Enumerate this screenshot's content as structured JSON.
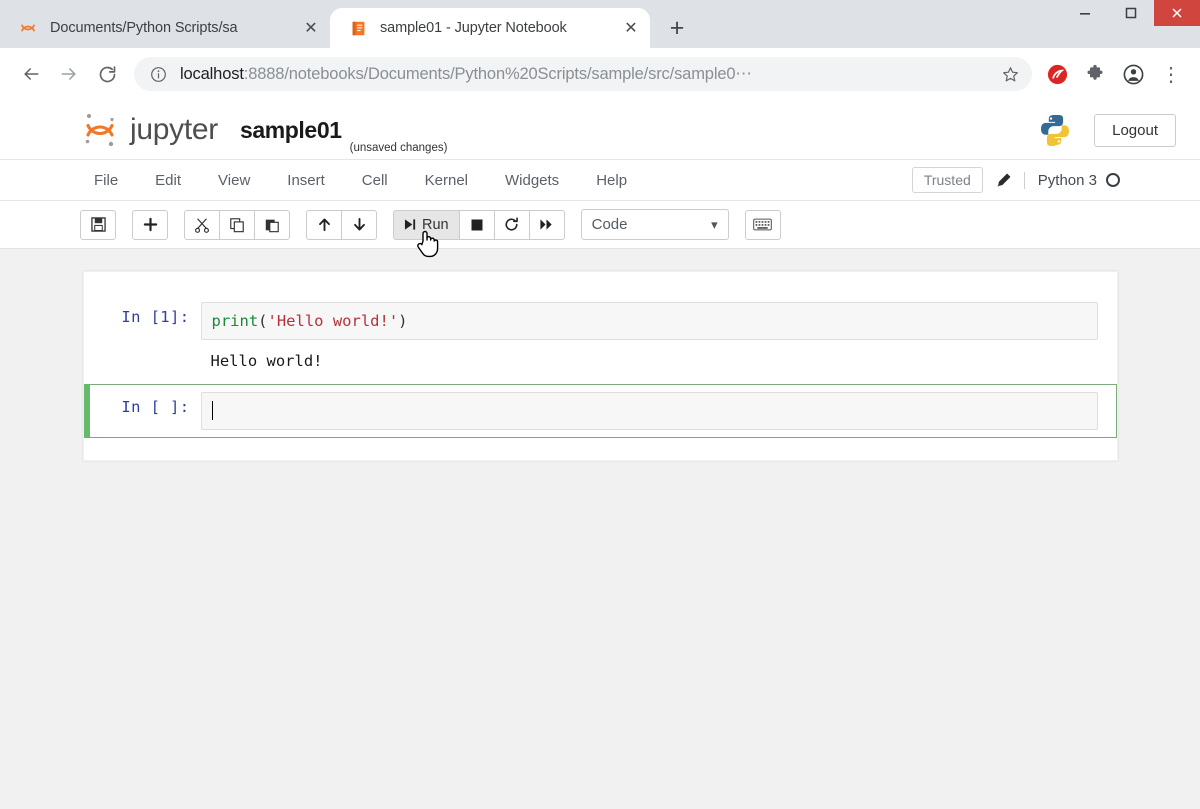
{
  "window": {
    "controls": [
      {
        "name": "minimize",
        "glyph": "—"
      },
      {
        "name": "maximize",
        "glyph": "❐"
      },
      {
        "name": "close",
        "glyph": "✕"
      }
    ]
  },
  "tabs": [
    {
      "title": "Documents/Python Scripts/sa",
      "favicon": "jupyter-icon",
      "active": false,
      "close_glyph": "✕"
    },
    {
      "title": "sample01 - Jupyter Notebook",
      "favicon": "notebook-icon",
      "active": true,
      "close_glyph": "✕"
    }
  ],
  "new_tab_glyph": "+",
  "browser_toolbar": {
    "back_glyph": "←",
    "forward_glyph": "→",
    "reload_glyph": "⟳",
    "info_glyph": "ⓘ",
    "url_host": "localhost",
    "url_rest": ":8888/notebooks/Documents/Python%20Scripts/sample/src/sample0⋯",
    "bookmark_glyph": "☆",
    "extensions": [
      "shield-extension-icon",
      "puzzle-extension-icon",
      "profile-avatar-icon",
      "chrome-menu-icon"
    ],
    "menu_glyph": "⋮"
  },
  "jupyter": {
    "wordmark": "jupyter",
    "notebook_name": "sample01",
    "save_status": "(unsaved changes)",
    "logout_label": "Logout",
    "menu": [
      "File",
      "Edit",
      "View",
      "Insert",
      "Cell",
      "Kernel",
      "Widgets",
      "Help"
    ],
    "trusted_label": "Trusted",
    "kernel_name": "Python 3",
    "toolbar": {
      "groups": [
        [
          {
            "name": "save-button",
            "glyph": "Ὃe",
            "icon": "save-icon",
            "label": ""
          }
        ],
        [
          {
            "name": "insert-cell-below-button",
            "glyph": "＋",
            "icon": "plus-icon",
            "label": ""
          }
        ],
        [
          {
            "name": "cut-cells-button",
            "glyph": "✄",
            "icon": "scissors-icon",
            "label": ""
          },
          {
            "name": "copy-cells-button",
            "glyph": "❐",
            "icon": "copy-icon",
            "label": ""
          },
          {
            "name": "paste-cells-button",
            "glyph": "Ὄb",
            "icon": "paste-icon",
            "label": ""
          }
        ],
        [
          {
            "name": "move-cell-up-button",
            "glyph": "↑",
            "icon": "arrow-up-icon",
            "label": ""
          },
          {
            "name": "move-cell-down-button",
            "glyph": "↓",
            "icon": "arrow-down-icon",
            "label": ""
          }
        ],
        [
          {
            "name": "run-button",
            "glyph": "▶❙",
            "icon": "run-icon",
            "label": "Run",
            "hovered": true
          },
          {
            "name": "interrupt-kernel-button",
            "glyph": "■",
            "icon": "stop-square-icon",
            "label": ""
          },
          {
            "name": "restart-kernel-button",
            "glyph": "⟳",
            "icon": "restart-icon",
            "label": ""
          },
          {
            "name": "restart-and-run-all-button",
            "glyph": "»",
            "icon": "fast-forward-icon",
            "label": ""
          }
        ]
      ],
      "cell_type_value": "Code",
      "cell_type_chevron": "▾",
      "command_palette_icon": "keyboard-icon"
    }
  },
  "notebook": {
    "cells": [
      {
        "prompt": "In [1]:",
        "code_tokens": [
          {
            "text": "print",
            "type": "fn"
          },
          {
            "text": "(",
            "type": "punct"
          },
          {
            "text": "'Hello world!'",
            "type": "str"
          },
          {
            "text": ")",
            "type": "punct"
          }
        ],
        "output": "Hello world!",
        "selected": false
      },
      {
        "prompt": "In [ ]:",
        "code_tokens": [],
        "output": null,
        "selected": true
      }
    ]
  },
  "colors": {
    "jupyter_orange": "#f37726",
    "selected_cell_green": "#66bb6a",
    "tab_strip_gray": "#dee1e6",
    "page_gray": "#f1f1f1",
    "close_button_red": "#d1453f",
    "prompt_blue": "#303f9f",
    "code_fn_green": "#1a8a3a",
    "code_string_red": "#b5313a"
  }
}
